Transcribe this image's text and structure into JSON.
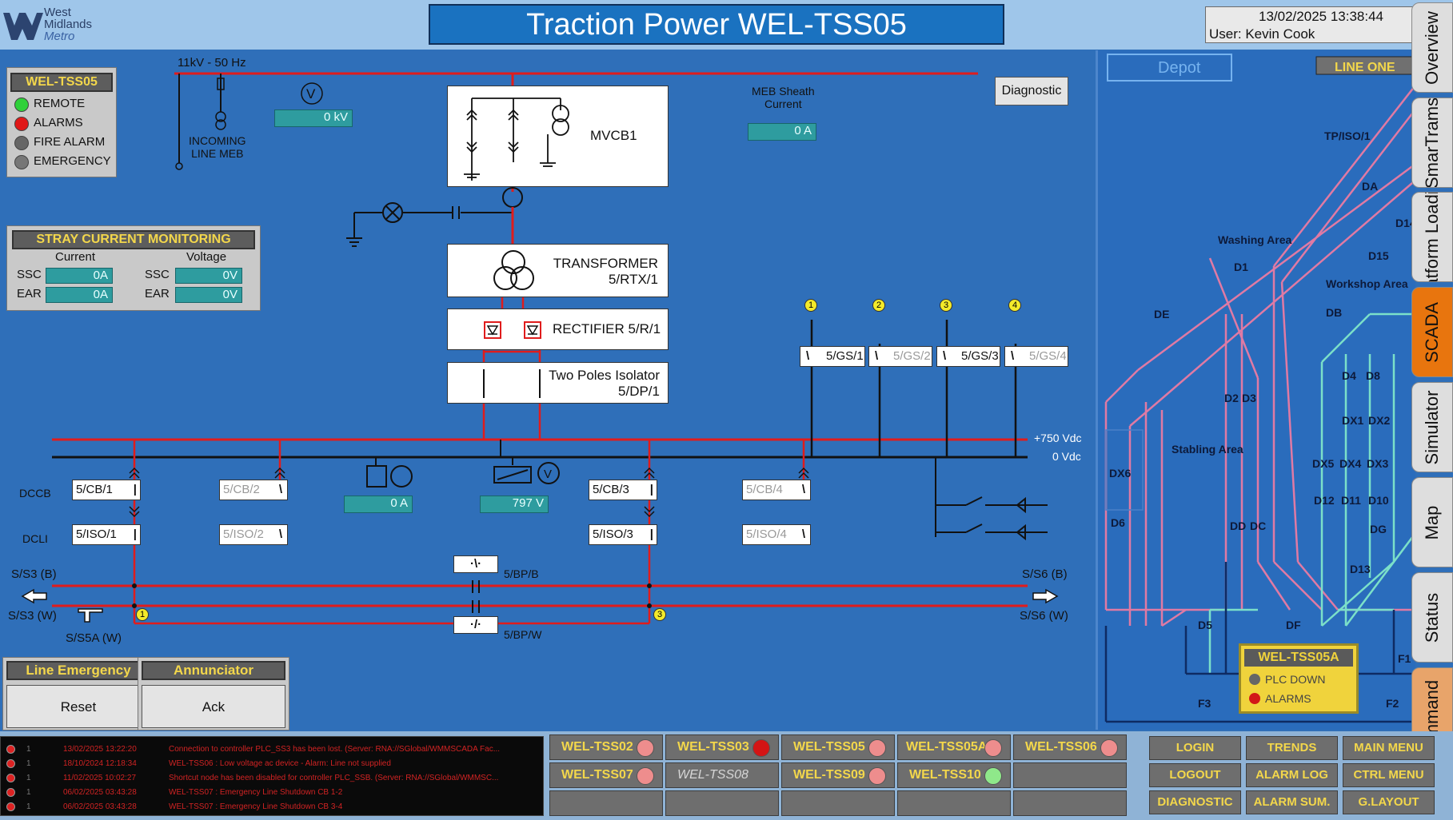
{
  "header": {
    "logo_line1": "West",
    "logo_line2": "Midlands",
    "logo_line3": "Metro",
    "title": "Traction Power WEL-TSS05",
    "datetime": "13/02/2025 13:38:44",
    "user": "User: Kevin Cook"
  },
  "status_panel": {
    "title": "WEL-TSS05",
    "items": [
      {
        "label": "REMOTE",
        "color": "#2fd13a"
      },
      {
        "label": "ALARMS",
        "color": "#e01818"
      },
      {
        "label": "FIRE ALARM",
        "color": "#666666"
      },
      {
        "label": "EMERGENCY",
        "color": "#777777"
      }
    ]
  },
  "stray_panel": {
    "title": "STRAY CURRENT MONITORING",
    "current_label": "Current",
    "voltage_label": "Voltage",
    "ssc_label": "SSC",
    "ear_label": "EAR",
    "ssc_current": "0A",
    "ear_current": "0A",
    "ssc_voltage": "0V",
    "ear_voltage": "0V"
  },
  "diagram": {
    "supply": "11kV - 50 Hz",
    "incoming_line1": "INCOMING",
    "incoming_line2": "LINE MEB",
    "kv_value": "0 kV",
    "meb_label1": "MEB Sheath",
    "meb_label2": "Current",
    "meb_value": "0 A",
    "diagnostic_button": "Diagnostic",
    "mvcb": "MVCB1",
    "transformer1": "TRANSFORMER",
    "transformer2": "5/RTX/1",
    "rectifier": "RECTIFIER 5/R/1",
    "isolator1": "Two Poles Isolator",
    "isolator2": "5/DP/1",
    "gs": [
      {
        "num": "1",
        "label": "5/GS/1",
        "dim": false
      },
      {
        "num": "2",
        "label": "5/GS/2",
        "dim": true
      },
      {
        "num": "3",
        "label": "5/GS/3",
        "dim": false
      },
      {
        "num": "4",
        "label": "5/GS/4",
        "dim": true
      }
    ],
    "vdc_pos": "+750 Vdc",
    "vdc_zero": "0 Vdc",
    "dccb_label": "DCCB",
    "dcli_label": "DCLI",
    "cb": [
      "5/CB/1",
      "5/CB/2",
      "5/CB/3",
      "5/CB/4"
    ],
    "iso": [
      "5/ISO/1",
      "5/ISO/2",
      "5/ISO/3",
      "5/ISO/4"
    ],
    "amp_value": "0 A",
    "volt_value": "797 V",
    "bpb": "5/BP/B",
    "bpw": "5/BP/W",
    "ss3b": "S/S3 (B)",
    "ss3w": "S/S3 (W)",
    "ss5a": "S/S5A (W)",
    "ss6b": "S/S6 (B)",
    "ss6w": "S/S6 (W)",
    "badge1": "1",
    "badge3": "3"
  },
  "line_emergency": {
    "title": "Line Emergency",
    "button": "Reset"
  },
  "annunciator": {
    "title": "Annunciator",
    "button": "Ack"
  },
  "depot_map": {
    "depot_label": "Depot",
    "line_one": "LINE ONE",
    "labels": [
      "TP/ISO/1",
      "DA",
      "D14",
      "Washing Area",
      "D15",
      "D1",
      "Workshop Area",
      "DE",
      "DB",
      "D4",
      "D8",
      "D2",
      "D3",
      "DX1",
      "DX2",
      "Stabling Area",
      "DX6",
      "DX5",
      "DX4",
      "DX3",
      "D12",
      "D11",
      "D10",
      "D6",
      "DD",
      "DC",
      "DG",
      "D13",
      "D5",
      "DF",
      "F1",
      "F3",
      "F2"
    ],
    "badge_title": "WEL-TSS05A",
    "badge_item1": "PLC DOWN",
    "badge_item2": "ALARMS"
  },
  "side_tabs": [
    "Overview",
    "SmarTrams",
    "Platform Loading",
    "SCADA",
    "Simulator",
    "Map",
    "Status",
    "Issue Command"
  ],
  "alarms": [
    {
      "n": "1",
      "t": "13/02/2025 13:22:20",
      "m": "Connection to controller PLC_SS3 has been lost. (Server: RNA://SGlobal/WMMSCADA Fac..."
    },
    {
      "n": "1",
      "t": "18/10/2024 12:18:34",
      "m": "WEL-TSS06 : Low voltage ac device - Alarm: Line not supplied"
    },
    {
      "n": "1",
      "t": "11/02/2025 10:02:27",
      "m": "Shortcut node has been disabled for controller PLC_SSB. (Server: RNA://SGlobal/WMMSC..."
    },
    {
      "n": "1",
      "t": "06/02/2025 03:43:28",
      "m": "WEL-TSS07 : Emergency Line Shutdown CB 1-2"
    },
    {
      "n": "1",
      "t": "06/02/2025 03:43:28",
      "m": "WEL-TSS07 : Emergency Line Shutdown CB 3-4"
    }
  ],
  "stations": [
    {
      "label": "WEL-TSS02",
      "light": "#ee8d8d",
      "dim": false
    },
    {
      "label": "WEL-TSS03",
      "light": "#d41414",
      "dim": false
    },
    {
      "label": "WEL-TSS05",
      "light": "#ee8d8d",
      "dim": false
    },
    {
      "label": "WEL-TSS05A",
      "light": "#ee8d8d",
      "dim": false
    },
    {
      "label": "WEL-TSS06",
      "light": "#ee8d8d",
      "dim": false
    },
    {
      "label": "WEL-TSS07",
      "light": "#ee8d8d",
      "dim": false
    },
    {
      "label": "WEL-TSS08",
      "light": "",
      "dim": true
    },
    {
      "label": "WEL-TSS09",
      "light": "#ee8d8d",
      "dim": false
    },
    {
      "label": "WEL-TSS10",
      "light": "#8fe88a",
      "dim": false
    }
  ],
  "nav": [
    "LOGIN",
    "TRENDS",
    "MAIN MENU",
    "LOGOUT",
    "ALARM LOG",
    "CTRL MENU",
    "DIAGNOSTIC",
    "ALARM SUM.",
    "G.LAYOUT"
  ]
}
